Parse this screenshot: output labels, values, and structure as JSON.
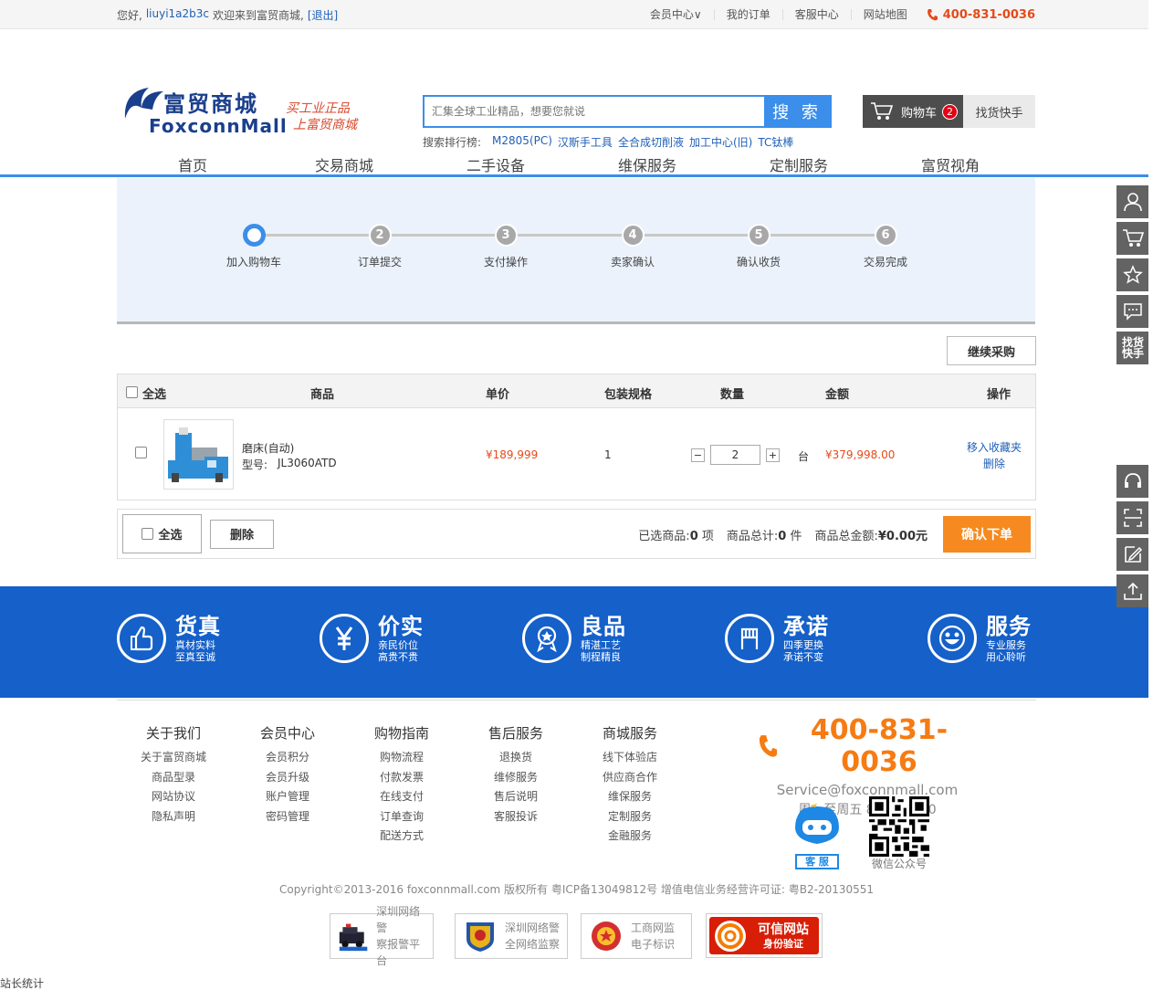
{
  "topbar": {
    "greeting": "您好,",
    "username": "liuyi1a2b3c",
    "welcome": "欢迎来到富贸商城,",
    "logout": "[退出]",
    "links": [
      "会员中心∨",
      "我的订单",
      "客服中心",
      "网站地图"
    ],
    "phone": "400-831-0036"
  },
  "header": {
    "logo_cn": "富贸商城",
    "logo_en": "FoxconnMall",
    "slogan_1": "买工业正品",
    "slogan_2": "上富贸商城",
    "search_placeholder": "汇集全球工业精品，想要您就说",
    "search_button": "搜 索",
    "hot_label": "搜索排行榜:",
    "hot_terms": [
      "M2805(PC)",
      "汉斯手工具",
      "全合成切削液",
      "加工中心(旧)",
      "TC钛棒"
    ],
    "cart_label": "购物车",
    "cart_count": "2",
    "find_label": "找货快手"
  },
  "nav": [
    "首页",
    "交易商城",
    "二手设备",
    "维保服务",
    "定制服务",
    "富贸视角"
  ],
  "steps": [
    {
      "num": "",
      "label": "加入购物车",
      "active": true
    },
    {
      "num": "2",
      "label": "订单提交"
    },
    {
      "num": "3",
      "label": "支付操作"
    },
    {
      "num": "4",
      "label": "卖家确认"
    },
    {
      "num": "5",
      "label": "确认收货"
    },
    {
      "num": "6",
      "label": "交易完成"
    }
  ],
  "continue_button": "继续采购",
  "table": {
    "headers": {
      "select_all": "全选",
      "product": "商品",
      "unit_price": "单价",
      "package": "包装规格",
      "quantity": "数量",
      "amount": "金额",
      "action": "操作"
    },
    "row": {
      "name": "磨床(自动)",
      "model_label": "型号:",
      "model": "JL3060ATD",
      "price": "¥189,999",
      "package": "1",
      "qty": "2",
      "unit": "台",
      "amount": "¥379,998.00",
      "fav": "移入收藏夹",
      "delete": "删除"
    }
  },
  "summary": {
    "select_all": "全选",
    "delete": "删除",
    "selected_label": "已选商品:",
    "selected_value": "0",
    "selected_unit": "项",
    "total_label": "商品总计:",
    "total_value": "0",
    "total_unit": "件",
    "amount_label": "商品总金额:",
    "amount_value": "¥0.00元",
    "confirm": "确认下单"
  },
  "promises": [
    {
      "title": "货真",
      "l1": "真材实料",
      "l2": "至真至诚",
      "icon": "thumbs-up-icon"
    },
    {
      "title": "价实",
      "l1": "亲民价位",
      "l2": "高贵不贵",
      "icon": "yen-icon"
    },
    {
      "title": "良品",
      "l1": "精湛工艺",
      "l2": "制程精良",
      "icon": "medal-icon"
    },
    {
      "title": "承诺",
      "l1": "四季更换",
      "l2": "承诺不变",
      "icon": "hand-icon"
    },
    {
      "title": "服务",
      "l1": "专业服务",
      "l2": "用心聆听",
      "icon": "smile-icon"
    }
  ],
  "footer_cols": [
    {
      "title": "关于我们",
      "items": [
        "关于富贸商城",
        "商品型录",
        "网站协议",
        "隐私声明"
      ]
    },
    {
      "title": "会员中心",
      "items": [
        "会员积分",
        "会员升级",
        "账户管理",
        "密码管理"
      ]
    },
    {
      "title": "购物指南",
      "items": [
        "购物流程",
        "付款发票",
        "在线支付",
        "订单查询",
        "配送方式"
      ]
    },
    {
      "title": "售后服务",
      "items": [
        "退换货",
        "维修服务",
        "售后说明",
        "客服投诉"
      ]
    },
    {
      "title": "商城服务",
      "items": [
        "线下体验店",
        "供应商合作",
        "维保服务",
        "定制服务",
        "金融服务"
      ]
    }
  ],
  "service": {
    "phone": "400-831-0036",
    "email": "Service@foxconnmall.com",
    "hours": "周一至周五 8:00-20:30",
    "robot_label": "客 服",
    "qr_label": "微信公众号"
  },
  "copyright": "Copyright©2013-2016 foxconnmall.com 版权所有 粤ICP备13049812号 增值电信业务经营许可证: 粤B2-20130551",
  "badges": [
    {
      "l1": "深圳网络警",
      "l2": "察报警平台"
    },
    {
      "l1": "深圳网络警",
      "l2": "全网络监察"
    },
    {
      "l1": "工商网监",
      "l2": "电子标识"
    },
    {
      "l1": "可信网站",
      "l2": "身份验证"
    }
  ],
  "stat": "站长统计",
  "sidebar": {
    "find_1": "找货",
    "find_2": "快手"
  },
  "colors": {
    "primary": "#3b8eea",
    "brand_blue": "#1560c9",
    "price": "#e64a19",
    "confirm": "#f6891f"
  }
}
